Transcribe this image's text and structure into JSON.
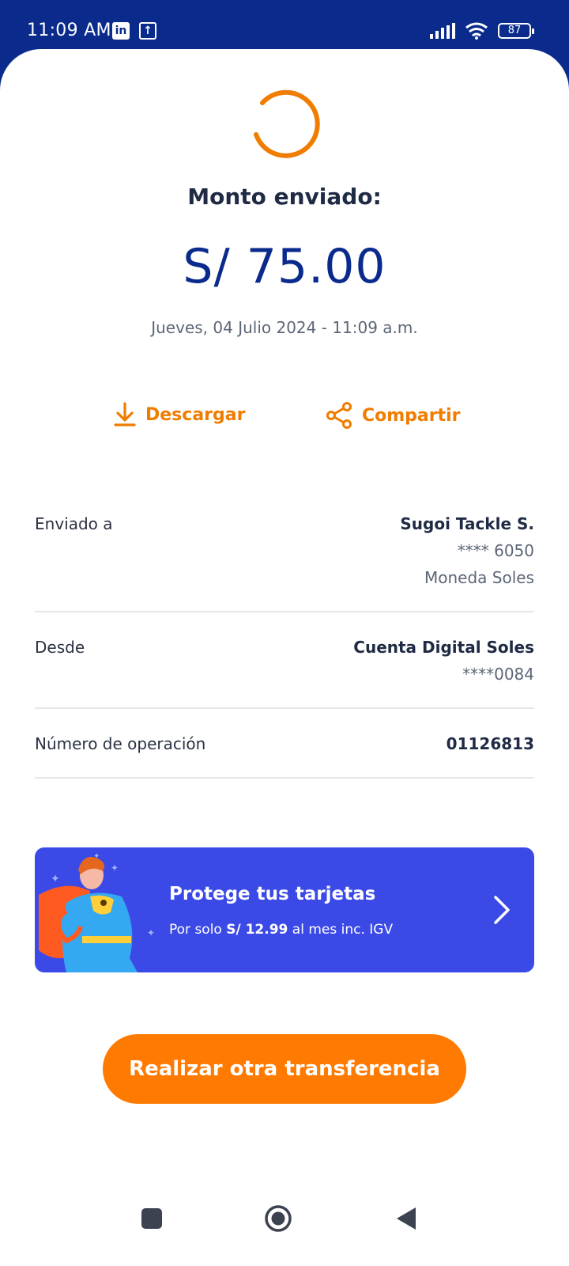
{
  "status_bar": {
    "time": "11:09 AM",
    "app_icons": [
      "linkedin-icon",
      "upload-icon"
    ],
    "battery": "87"
  },
  "header": {
    "title": "Monto enviado:",
    "amount": "S/ 75.00",
    "datetime": "Jueves, 04 Julio 2024 - 11:09 a.m."
  },
  "actions": {
    "download": "Descargar",
    "share": "Compartir"
  },
  "details": {
    "sent_to": {
      "label": "Enviado a",
      "name": "Sugoi Tackle S.",
      "account": "**** 6050",
      "currency": "Moneda Soles"
    },
    "from": {
      "label": "Desde",
      "account_name": "Cuenta Digital Soles",
      "account_number": "****0084"
    },
    "operation": {
      "label": "Número de operación",
      "value": "01126813"
    }
  },
  "promo": {
    "title": "Protege tus tarjetas",
    "sub_prefix": "Por solo",
    "price": "S/ 12.99",
    "sub_suffix": "al mes inc. IGV"
  },
  "cta": {
    "label": "Realizar otra transferencia"
  },
  "colors": {
    "brand_blue": "#0a2a8c",
    "accent_orange": "#ff7a00",
    "promo_bg": "#3b4ae6"
  }
}
